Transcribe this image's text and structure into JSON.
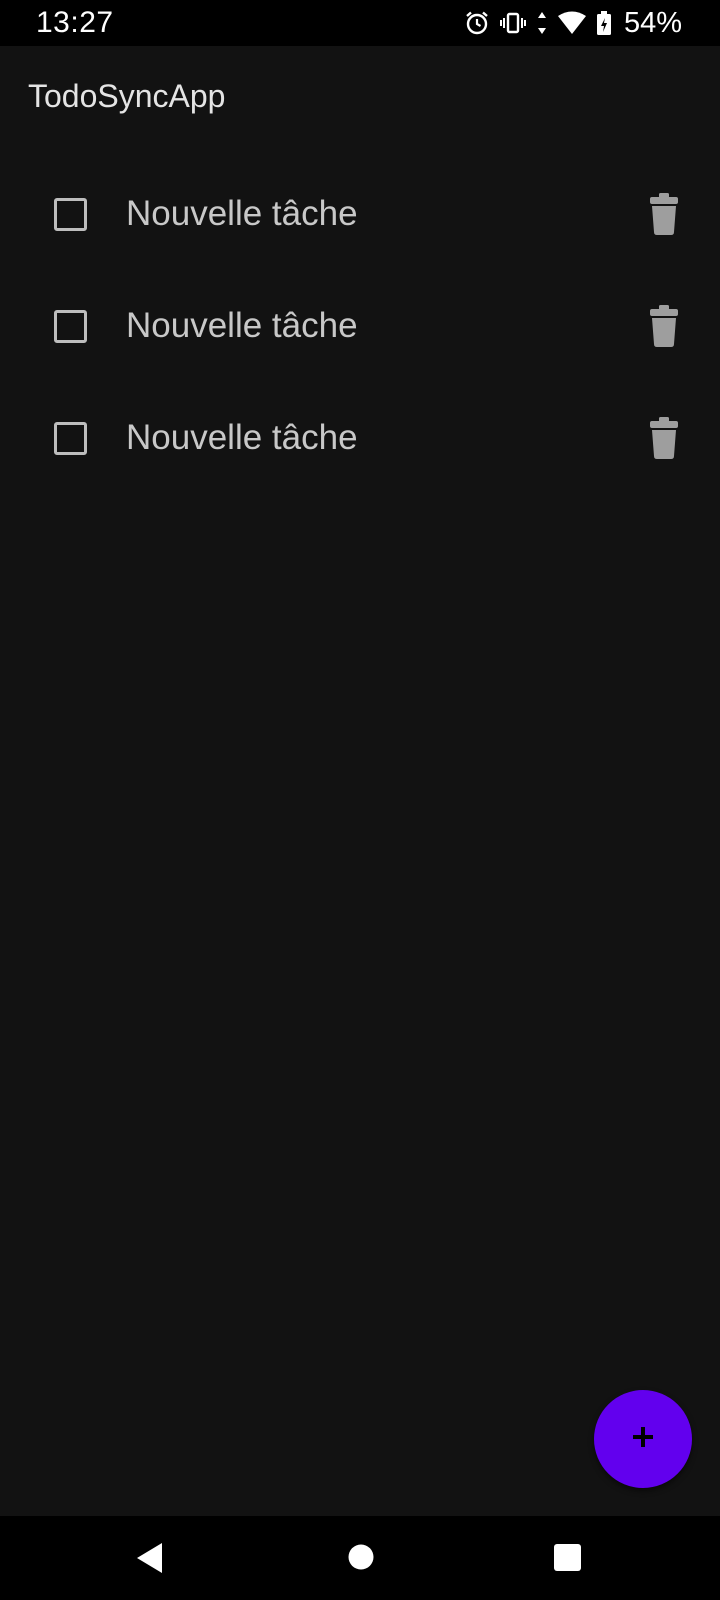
{
  "status_bar": {
    "time": "13:27",
    "battery_percent": "54%",
    "icons": [
      "alarm-icon",
      "vibrate-icon",
      "data-arrows-icon",
      "wifi-icon",
      "battery-icon"
    ]
  },
  "app_bar": {
    "title": "TodoSyncApp"
  },
  "todos": [
    {
      "label": "Nouvelle tâche",
      "checked": false
    },
    {
      "label": "Nouvelle tâche",
      "checked": false
    },
    {
      "label": "Nouvelle tâche",
      "checked": false
    }
  ],
  "fab": {
    "icon": "plus-icon",
    "color": "#6200ee"
  },
  "nav_bar": {
    "buttons": [
      "back-icon",
      "home-icon",
      "recents-icon"
    ]
  },
  "colors": {
    "background": "#121212",
    "text": "#c8c8c8",
    "accent": "#6200ee"
  }
}
